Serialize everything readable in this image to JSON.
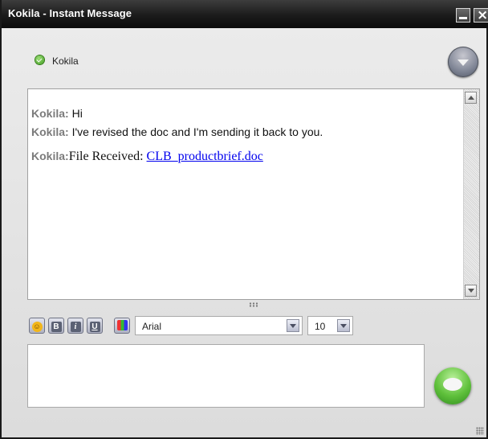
{
  "window": {
    "title": "Kokila - Instant Message"
  },
  "contact": {
    "name": "Kokila",
    "status": "online",
    "status_icon": "check-circle-icon",
    "status_color": "#4caf2a"
  },
  "conversation": {
    "messages": [
      {
        "sender": "Kokila:",
        "text": "Hi"
      },
      {
        "sender": "Kokila:",
        "text": "I've revised the doc and I'm sending it back to you."
      },
      {
        "sender": "Kokila:",
        "text": "File Received: ",
        "link": "CLB_productbrief.doc"
      }
    ]
  },
  "toolbar": {
    "emoji_icon": "smiley-icon",
    "bold_label": "B",
    "italic_label": "i",
    "underline_label": "U",
    "color_icon": "color-palette-icon",
    "font": "Arial",
    "size": "10"
  },
  "colors": {
    "titlebar": "#1b1b1b",
    "link": "#0000ee",
    "sender": "#7b7b7b",
    "send_button": "#5fc03b"
  }
}
